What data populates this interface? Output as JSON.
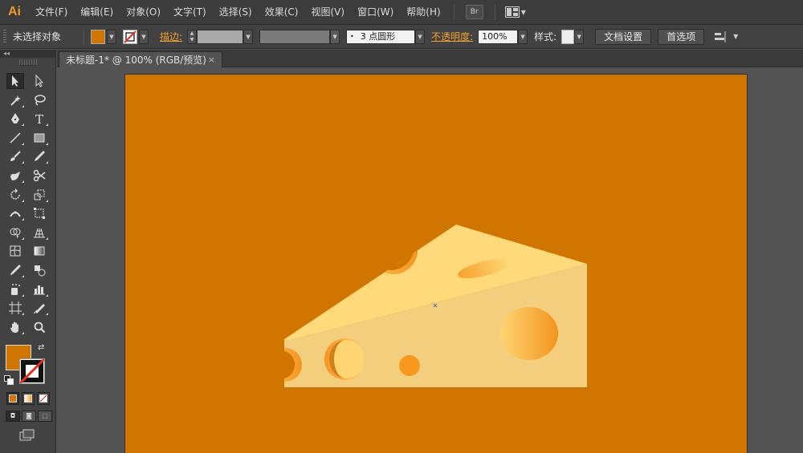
{
  "app": {
    "logo": "Ai"
  },
  "menu": {
    "items": [
      "文件(F)",
      "编辑(E)",
      "对象(O)",
      "文字(T)",
      "选择(S)",
      "效果(C)",
      "视图(V)",
      "窗口(W)",
      "帮助(H)"
    ],
    "bridge_label": "Br"
  },
  "control_bar": {
    "selection_status": "未选择对象",
    "fill_color": "#d07500",
    "stroke_label": "描边:",
    "brush_value": "3 点圆形",
    "opacity_label": "不透明度:",
    "opacity_value": "100%",
    "style_label": "样式:",
    "doc_setup_button": "文档设置",
    "preferences_button": "首选项"
  },
  "tabs": {
    "document_title": "未标题-1* @ 100% (RGB/预览)",
    "close_symbol": "×",
    "collapse_symbol": "◂◂"
  },
  "tools": [
    "selection-tool",
    "direct-selection-tool",
    "magic-wand-tool",
    "lasso-tool",
    "pen-tool",
    "type-tool",
    "line-tool",
    "rectangle-tool",
    "paintbrush-tool",
    "pencil-tool",
    "blob-brush-tool",
    "scissors-tool",
    "rotate-tool",
    "scale-tool",
    "width-tool",
    "free-transform-tool",
    "shape-builder-tool",
    "perspective-grid-tool",
    "mesh-tool",
    "gradient-tool",
    "eyedropper-tool",
    "blend-tool",
    "symbol-sprayer-tool",
    "column-graph-tool",
    "artboard-tool",
    "slice-tool",
    "hand-tool",
    "zoom-tool"
  ],
  "colors": {
    "fill": "#d07500",
    "stroke": "none",
    "artboard_bg": "#d07500",
    "cheese_top": "#ffd97a",
    "cheese_front": "#f3cf7d",
    "hole": "#f7991e"
  }
}
